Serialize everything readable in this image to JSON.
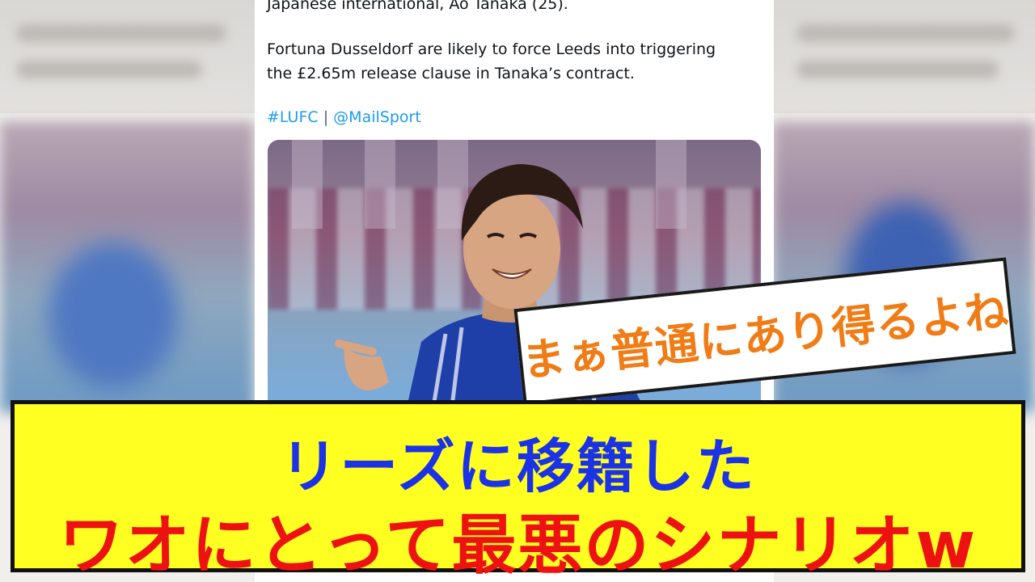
{
  "tweet": {
    "line1": "Japanese international, Ao Tanaka (25).",
    "line2": "Fortuna Dusseldorf are likely to force Leeds into triggering",
    "line3": "the £2.65m release clause in Tanaka’s contract.",
    "hashtag": "#LUFC",
    "separator": "|",
    "mention": "@MailSport"
  },
  "bubble": {
    "text": "まぁ普通にあり得るよね"
  },
  "caption": {
    "line1": "リーズに移籍した",
    "line2": "ワオにとって最悪のシナリオw"
  },
  "colors": {
    "caption_bg": "#ffff22",
    "caption_line1": "#1b32e6",
    "caption_line2": "#ee1111",
    "bubble_text": "#f07c16",
    "link": "#1d9bf0"
  }
}
